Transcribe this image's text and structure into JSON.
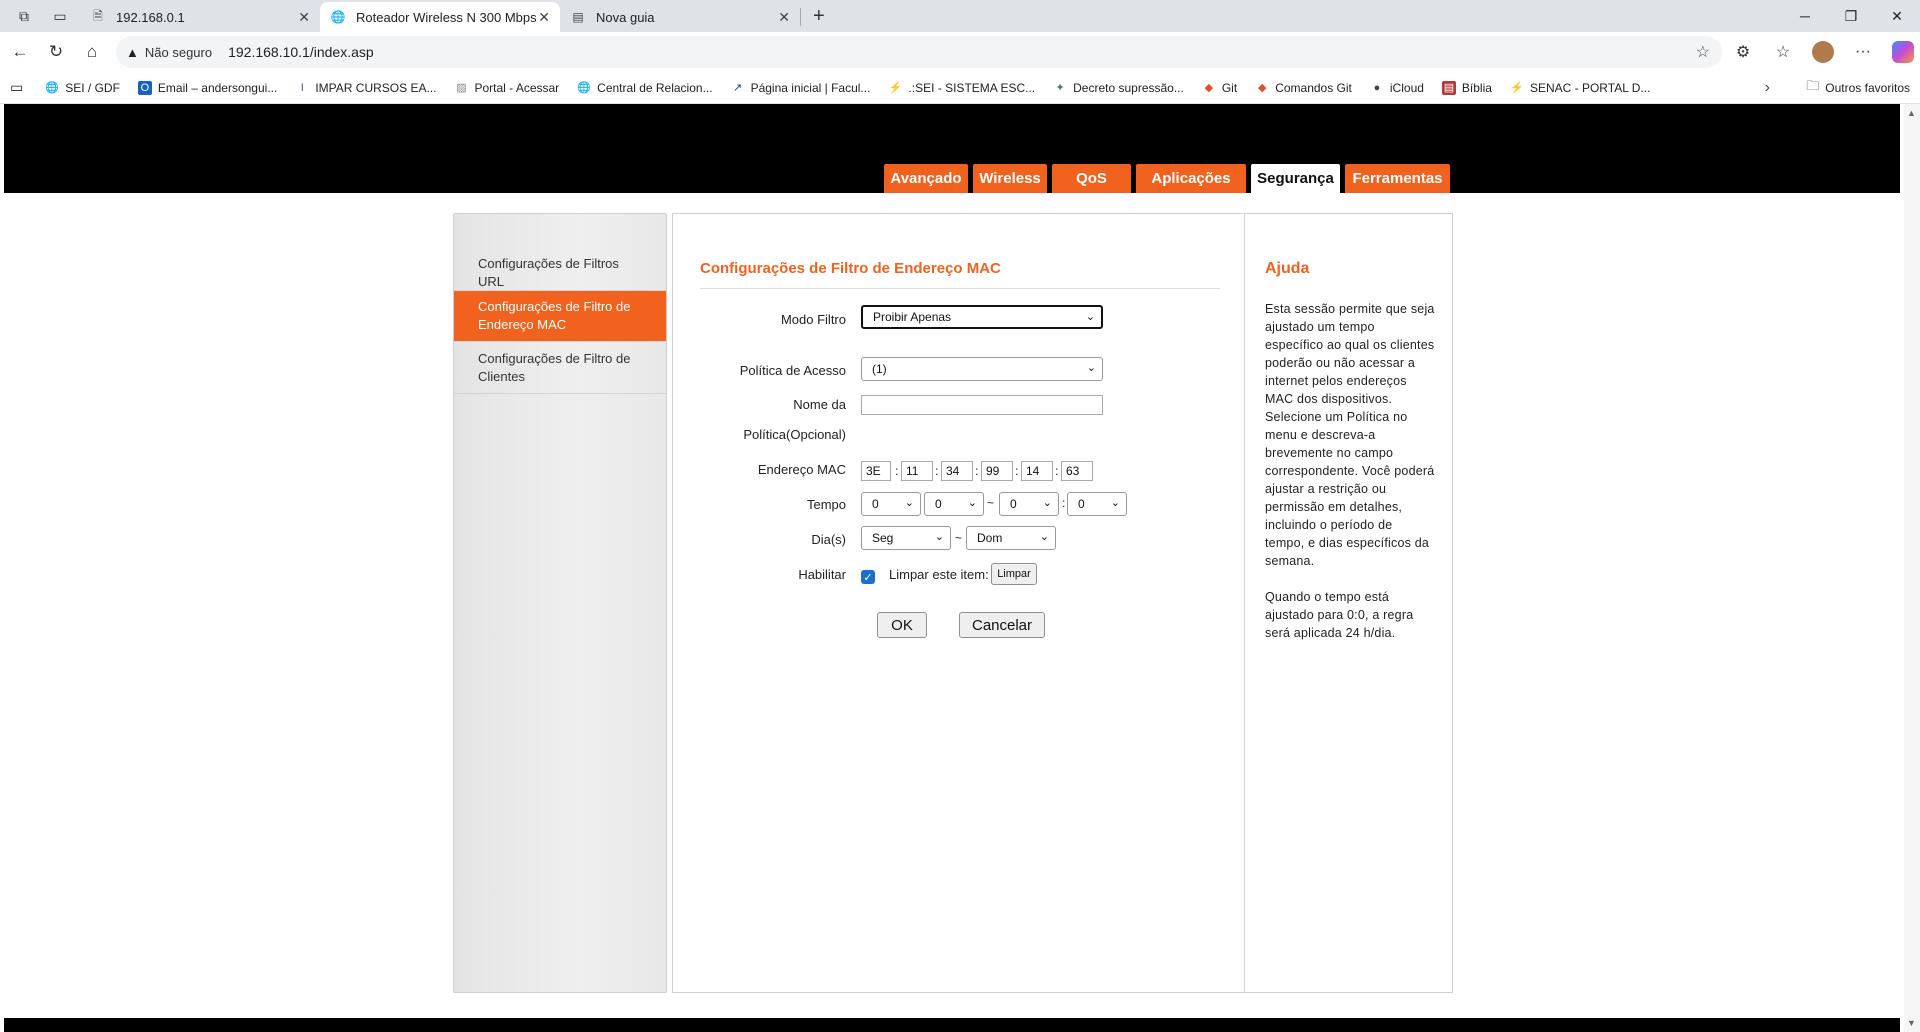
{
  "browser": {
    "tabs": [
      {
        "title": "192.168.0.1"
      },
      {
        "title": "Roteador Wireless N 300 Mbps"
      },
      {
        "title": "Nova guia"
      }
    ],
    "not_secure_label": "Não seguro",
    "url": "192.168.10.1/index.asp",
    "bookmarks": [
      "SEI / GDF",
      "Email – andersongui...",
      "IMPAR CURSOS EA...",
      "Portal - Acessar",
      "Central de Relacion...",
      "Página inicial | Facul...",
      ".:SEI - SISTEMA ESC...",
      "Decreto supressão...",
      "Git",
      "Comandos Git",
      "iCloud",
      "Bíblia",
      "SENAC - PORTAL D..."
    ],
    "other_favorites": "Outros favoritos"
  },
  "router": {
    "menu": [
      {
        "label": "Avançado"
      },
      {
        "label": "Wireless"
      },
      {
        "label": "QoS"
      },
      {
        "label": "Aplicações"
      },
      {
        "label": "Segurança"
      },
      {
        "label": "Ferramentas"
      }
    ],
    "selected_menu": "Segurança",
    "sidebar": [
      {
        "label": "Configurações de Filtros URL"
      },
      {
        "label": "Configurações de Filtro de Endereço MAC"
      },
      {
        "label": "Configurações de Filtro de Clientes"
      }
    ],
    "content": {
      "title": "Configurações de Filtro de Endereço MAC",
      "modo_filtro_label": "Modo Filtro",
      "modo_filtro_value": "Proibir Apenas",
      "politica_label": "Política de Acesso",
      "politica_value": "(1)",
      "nome_label_1": "Nome da",
      "nome_label_2": "Política(Opcional)",
      "nome_value": "",
      "mac_label": "Endereço MAC",
      "mac": [
        "3E",
        "11",
        "34",
        "99",
        "14",
        "63"
      ],
      "mac_sep": ":",
      "tempo_label": "Tempo",
      "tempo": [
        "0",
        "0",
        "0",
        "0"
      ],
      "range_sep": "~",
      "dias_label": "Dia(s)",
      "dia_inicio": "Seg",
      "dia_fim": "Dom",
      "habilitar_label": "Habilitar",
      "habilitar_checked": true,
      "limpar_item_label": "Limpar este item:",
      "limpar_button": "Limpar",
      "ok_button": "OK",
      "cancel_button": "Cancelar"
    },
    "help": {
      "title": "Ajuda",
      "paragraph1": "Esta sessão permite que seja ajustado um tempo específico ao qual os clientes poderão ou não acessar a internet pelos endereços MAC dos dispositivos. Selecione um Política no menu e descreva-a brevemente no campo correspondente. Você poderá ajustar a restrição ou permissão em detalhes, incluindo o período de tempo, e dias específicos da semana.",
      "paragraph2": "Quando o tempo está ajustado para 0:0, a regra será aplicada 24 h/dia."
    }
  },
  "colors": {
    "accent": "#f0621e",
    "header": "#000000"
  }
}
